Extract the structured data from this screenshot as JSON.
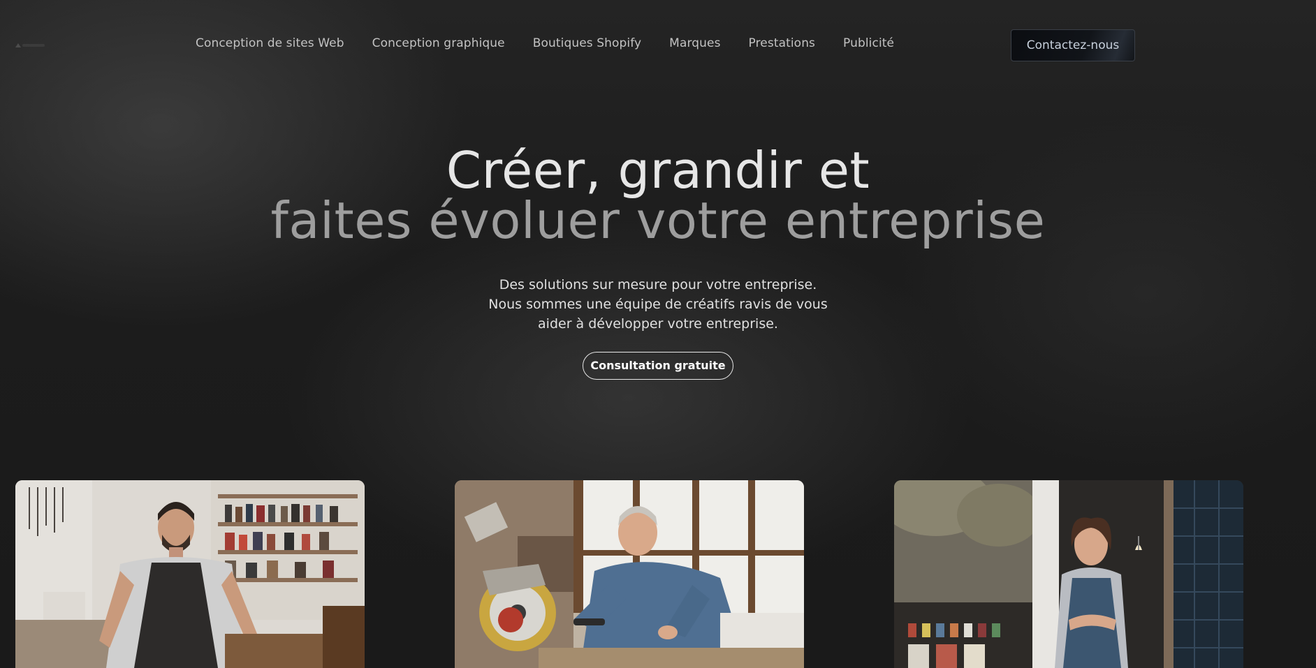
{
  "nav": {
    "items": [
      "Conception de sites Web",
      "Conception graphique",
      "Boutiques Shopify",
      "Marques",
      "Prestations",
      "Publicité"
    ],
    "contact_label": "Contactez-nous"
  },
  "hero": {
    "title_line1": "Créer, grandir et",
    "title_line2": "faites évoluer votre entreprise",
    "tagline": "Des solutions sur mesure pour votre entreprise. Nous sommes une équipe de créatifs ravis de vous aider à développer votre entreprise.",
    "cta_label": "Consultation gratuite"
  },
  "colors": {
    "background": "#1a1a1a",
    "title_primary": "#e6e6e6",
    "title_secondary": "#9e9e9e",
    "contact_button_bg": "#0f1216"
  }
}
